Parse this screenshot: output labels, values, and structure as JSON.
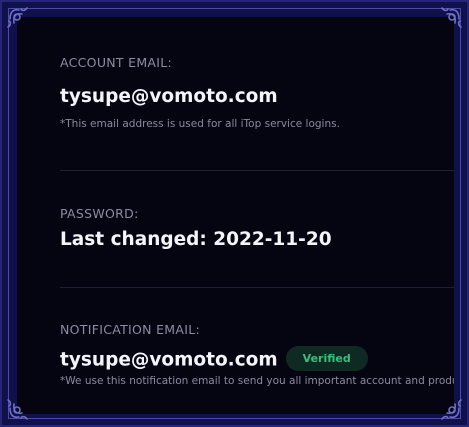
{
  "account": {
    "label": "ACCOUNT EMAIL:",
    "email": "tysupe@vomoto.com",
    "note": "*This email address is used for all iTop service logins."
  },
  "password": {
    "label": "PASSWORD:",
    "value": "Last changed: 2022-11-20"
  },
  "notification": {
    "label": "NOTIFICATION EMAIL:",
    "email": "tysupe@vomoto.com",
    "badge": "Verified",
    "note": "*We use this notification email to send you all important account and product news."
  },
  "colors": {
    "frame": "#10104a",
    "panel": "#050512",
    "verified": "#36c07a"
  },
  "icons": {
    "corners": "ornament-corner-icon"
  }
}
